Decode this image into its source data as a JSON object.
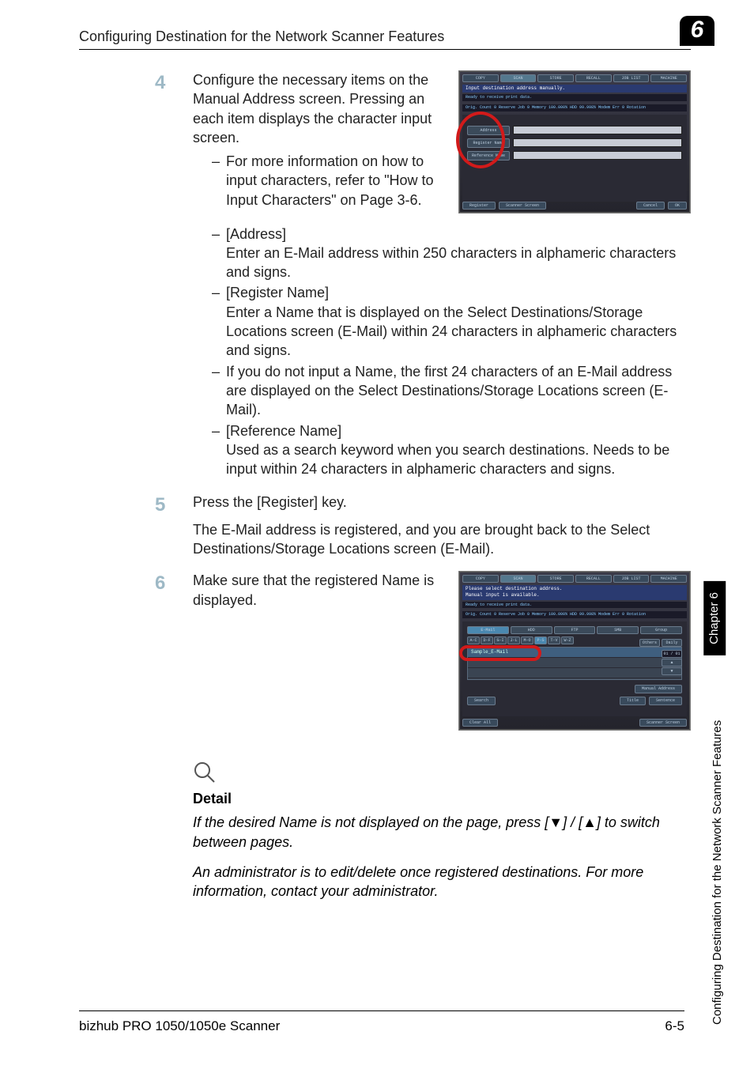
{
  "header": {
    "title": "Configuring Destination for the Network Scanner Features",
    "chapter_badge": "6"
  },
  "steps": {
    "s4": {
      "num": "4",
      "para1": "Configure the necessary items on the Manual Address screen. Pressing an each item displays the character input screen.",
      "b1": "For more information on how to input characters, refer to \"How to Input Characters\" on Page 3-6.",
      "b2_label": "[Address]",
      "b2_text": "Enter an E-Mail address within 250 characters in alphameric characters and signs.",
      "b3_label": "[Register Name]",
      "b3_text": "Enter a Name that is displayed on the Select Destinations/Storage Locations screen (E-Mail) within 24 characters in alphameric characters and signs.",
      "b4": "If you do not input a Name, the first 24 characters of an E-Mail address are displayed on the Select Destinations/Storage Locations screen (E-Mail).",
      "b5_label": "[Reference Name]",
      "b5_text": "Used as a search keyword when you search destinations. Needs to be input within 24 characters in alphameric characters and signs."
    },
    "s5": {
      "num": "5",
      "para1": "Press the [Register] key.",
      "para2": "The E-Mail address is registered, and you are brought back to the Select Destinations/Storage Locations screen (E-Mail)."
    },
    "s6": {
      "num": "6",
      "para1": "Make sure that the registered Name is displayed."
    }
  },
  "detail": {
    "title": "Detail",
    "para1": "If the desired Name is not displayed on the page, press [▼] / [▲] to switch between pages.",
    "para2": "An administrator is to edit/delete once registered destinations. For more information, contact your administrator."
  },
  "side": {
    "chapter": "Chapter 6",
    "section": "Configuring Destination for the Network Scanner Features"
  },
  "footer": {
    "left": "bizhub PRO 1050/1050e Scanner",
    "right": "6-5"
  },
  "screenshot1": {
    "tabs": [
      "COPY",
      "SCAN",
      "STORE",
      "RECALL",
      "JOB LIST",
      "MACHINE"
    ],
    "strip": "Input destination address manually.",
    "status_a": "Ready to receive print data.",
    "status_b": "Orig. Count    0 Reserve Job   0 Memory  100.000% HDD       99.998% Modem Err 0 Rotation",
    "labels": {
      "address": "Address",
      "regname": "Register Name",
      "refname": "Reference Name"
    },
    "foot": {
      "register": "Register",
      "scanner": "Scanner Screen",
      "cancel": "Cancel",
      "ok": "OK"
    }
  },
  "screenshot2": {
    "tabs": [
      "COPY",
      "SCAN",
      "STORE",
      "RECALL",
      "JOB LIST",
      "MACHINE"
    ],
    "strip": "Please select destination address.\nManual input is available.",
    "status_a": "Ready to receive print data.",
    "status_b": "Orig. Count    0 Reserve Job   0 Memory  100.000% HDD       99.998% Modem Err 0 Rotation",
    "typetabs": [
      "E-Mail",
      "HDD",
      "FTP",
      "SMB",
      "Group"
    ],
    "letters": [
      "A-C",
      "D-F",
      "G-I",
      "J-L",
      "M-O",
      "P-S",
      "T-V",
      "W-Z"
    ],
    "util": {
      "others": "Others",
      "daily": "Daily"
    },
    "list_item": "Sample_E-Mail",
    "page": "01 / 01",
    "manual": "Manual Address",
    "foot": {
      "search": "Search",
      "title": "Title",
      "sentence": "Sentence",
      "clear": "Clear All",
      "scanner": "Scanner Screen"
    }
  }
}
